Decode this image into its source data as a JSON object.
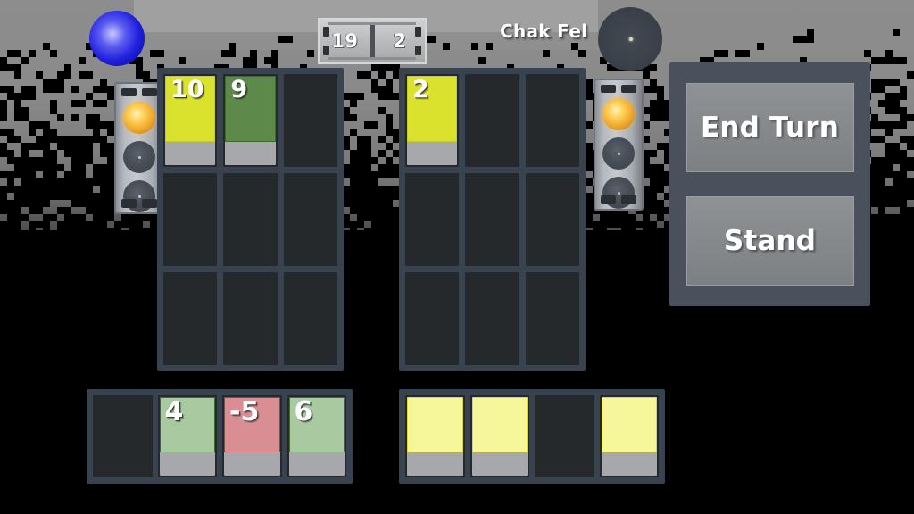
{
  "hud": {
    "scores": [
      {
        "label": "19",
        "name": "player-score"
      },
      {
        "label": "2",
        "name": "opponent-score"
      }
    ],
    "player_name": "Chak Fel",
    "blue_orb_icon": "blue-orb-icon",
    "dark_orb_icon": "dark-orb-icon"
  },
  "towers": [
    {
      "name": "left-signal-tower",
      "lamp": "amber-lamp-lit",
      "state": "lit"
    },
    {
      "name": "right-signal-tower",
      "lamp": "amber-lamp-lit",
      "state": "lit"
    }
  ],
  "boards": {
    "left": {
      "name": "player-board",
      "cells": [
        {
          "card": {
            "value": "10",
            "color": "yellow",
            "face": "up"
          }
        },
        {
          "card": {
            "value": "9",
            "color": "green",
            "face": "up"
          }
        },
        {
          "card": null
        },
        {
          "card": null
        },
        {
          "card": null
        },
        {
          "card": null
        },
        {
          "card": null
        },
        {
          "card": null
        },
        {
          "card": null
        }
      ]
    },
    "right": {
      "name": "opponent-board",
      "cells": [
        {
          "card": {
            "value": "2",
            "color": "yellow",
            "face": "up"
          }
        },
        {
          "card": null
        },
        {
          "card": null
        },
        {
          "card": null
        },
        {
          "card": null
        },
        {
          "card": null
        },
        {
          "card": null
        },
        {
          "card": null
        },
        {
          "card": null
        }
      ]
    }
  },
  "hands": {
    "left": {
      "name": "player-hand",
      "slots": [
        {
          "card": null
        },
        {
          "card": {
            "value": "4",
            "color": "mint",
            "face": "up"
          }
        },
        {
          "card": {
            "value": "-5",
            "color": "red",
            "face": "up"
          }
        },
        {
          "card": {
            "value": "6",
            "color": "mint",
            "face": "up"
          }
        }
      ]
    },
    "right": {
      "name": "opponent-hand",
      "slots": [
        {
          "card": {
            "value": "",
            "color": "back",
            "face": "down"
          }
        },
        {
          "card": {
            "value": "",
            "color": "back",
            "face": "down"
          }
        },
        {
          "card": null
        },
        {
          "card": {
            "value": "",
            "color": "back",
            "face": "down"
          }
        }
      ]
    }
  },
  "actions": {
    "end_turn_label": "End Turn",
    "stand_label": "Stand"
  },
  "colors": {
    "card_yellow": "#dbe22e",
    "card_green": "#5d8a4a",
    "card_mint": "#a9c9a1",
    "card_red": "#d98e93",
    "card_back": "#f5f79a",
    "board_frame": "#39434f",
    "cell": "#26292c",
    "panel": "#4a515c",
    "button": "#86898c",
    "orb_blue": "#2020e0",
    "lamp_amber": "#f0a92c"
  }
}
